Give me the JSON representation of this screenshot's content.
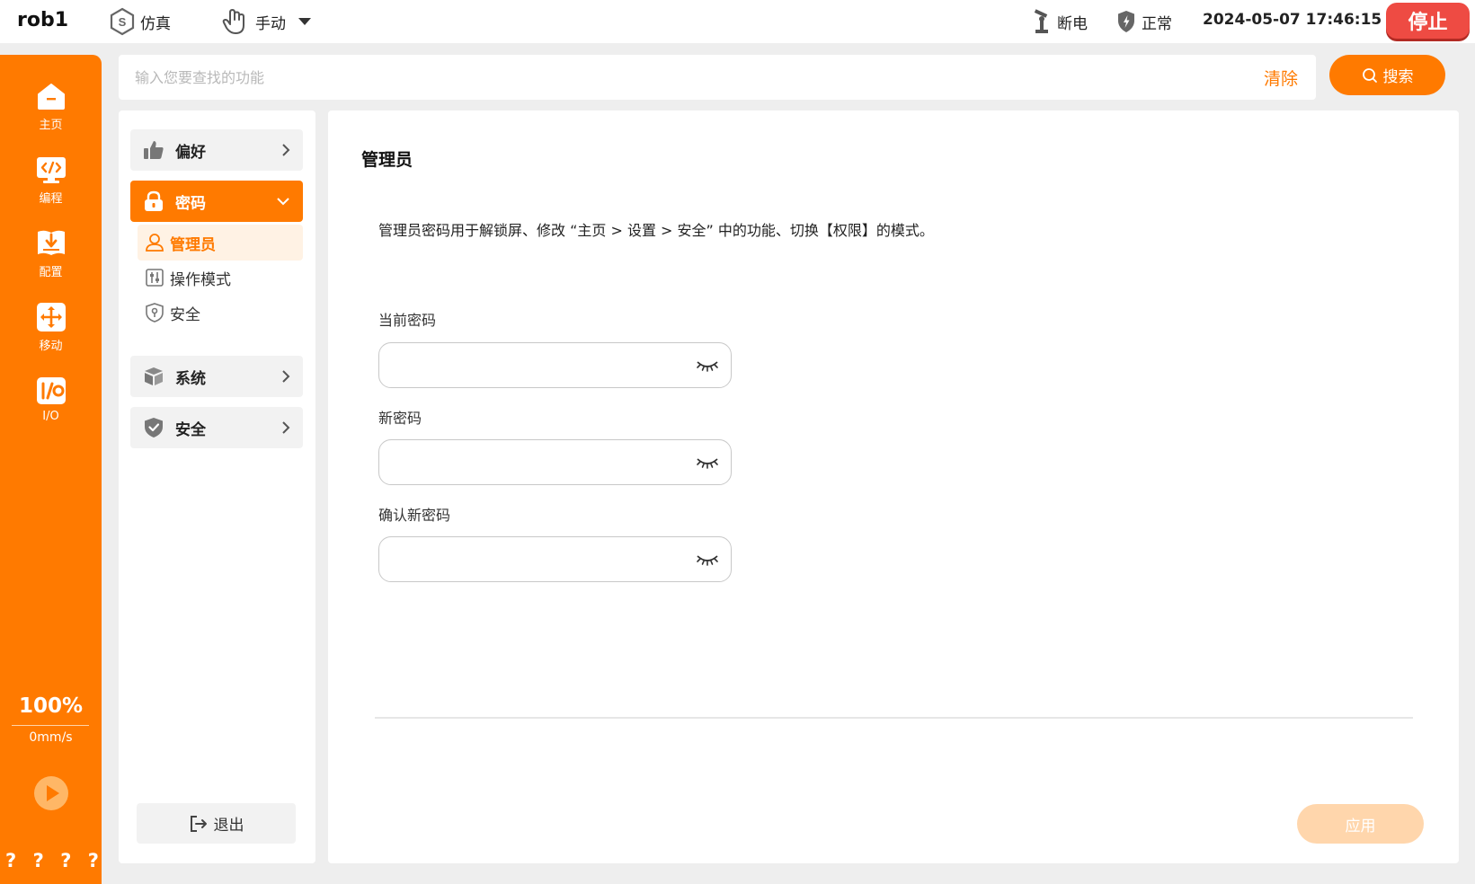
{
  "topbar": {
    "robot_name": "rob1",
    "sim_label": "仿真",
    "mode_label": "手动",
    "power_label": "断电",
    "state_label": "正常",
    "datetime": "2024-05-07 17:46:15",
    "stop_label": "停止"
  },
  "leftnav": {
    "items": [
      {
        "label": "主页",
        "icon": "home-icon"
      },
      {
        "label": "编程",
        "icon": "code-icon"
      },
      {
        "label": "配置",
        "icon": "config-icon"
      },
      {
        "label": "移动",
        "icon": "move-icon"
      },
      {
        "label": "I/O",
        "icon": "io-icon"
      }
    ],
    "speed_percent": "100%",
    "speed_value": "0mm/s",
    "help_marks": [
      "?",
      "?",
      "?",
      "?"
    ]
  },
  "search": {
    "placeholder": "输入您要查找的功能",
    "clear_label": "清除",
    "search_label": "搜索"
  },
  "menu": {
    "preference": "偏好",
    "password": "密码",
    "sub_items": [
      "管理员",
      "操作模式",
      "安全"
    ],
    "system": "系统",
    "security": "安全",
    "logout": "退出"
  },
  "content": {
    "title": "管理员",
    "description": "管理员密码用于解锁屏、修改 “主页 > 设置 > 安全” 中的功能、切换【权限】的模式。",
    "fields": [
      {
        "label": "当前密码",
        "value": ""
      },
      {
        "label": "新密码",
        "value": ""
      },
      {
        "label": "确认新密码",
        "value": ""
      }
    ],
    "apply_label": "应用"
  },
  "colors": {
    "accent": "#ff7a00",
    "stop": "#ee4b43",
    "apply_disabled": "#ffd6ac"
  }
}
